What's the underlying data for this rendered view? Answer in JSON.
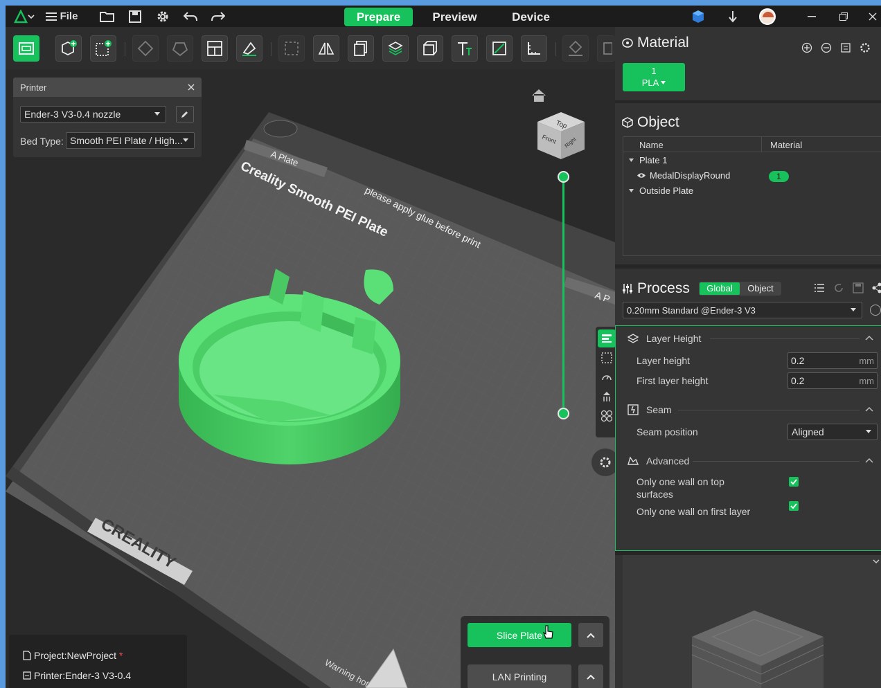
{
  "titlebar": {
    "file_label": "File",
    "tabs": [
      {
        "label": "Prepare"
      },
      {
        "label": "Preview"
      },
      {
        "label": "Device"
      }
    ]
  },
  "printer_panel": {
    "title": "Printer",
    "printer": "Ender-3 V3-0.4 nozzle",
    "bed_type_label": "Bed Type:",
    "bed_type": "Smooth PEI Plate / High..."
  },
  "plate": {
    "name": "A Plate",
    "brand_text": "Creality Smooth PEI Plate",
    "notice": "please apply glue before print",
    "logo": "CREALITY",
    "warning": "Warning hot"
  },
  "cube": {
    "top": "Top",
    "front": "Front",
    "right": "Right"
  },
  "status": {
    "project": "Project:NewProject",
    "project_modified": "*",
    "printer": "Printer:Ender-3 V3-0.4"
  },
  "actions": {
    "slice": "Slice Plate",
    "lan": "LAN Printing"
  },
  "material": {
    "title": "Material",
    "slots": [
      {
        "index": "1",
        "type": "PLA"
      }
    ],
    "accent": "#17c15c"
  },
  "object": {
    "title": "Object",
    "columns": [
      "Name",
      "Material"
    ],
    "tree": [
      {
        "label": "Plate 1"
      },
      {
        "label": "MedalDisplayRound",
        "material": "1"
      },
      {
        "label": "Outside Plate"
      }
    ]
  },
  "process": {
    "title": "Process",
    "modes": [
      "Global",
      "Object"
    ],
    "preset": "0.20mm Standard @Ender-3 V3",
    "groups": {
      "layer_height": {
        "title": "Layer Height",
        "layer_height_label": "Layer height",
        "layer_height_value": "0.2",
        "first_layer_height_label": "First layer height",
        "first_layer_height_value": "0.2",
        "unit": "mm"
      },
      "seam": {
        "title": "Seam",
        "seam_position_label": "Seam position",
        "seam_position_value": "Aligned"
      },
      "advanced": {
        "title": "Advanced",
        "top_surfaces_label_1": "Only one wall on top",
        "top_surfaces_label_2": "surfaces",
        "top_surfaces_checked": true,
        "first_layer_label": "Only one wall on first layer",
        "first_layer_checked": true
      }
    }
  }
}
